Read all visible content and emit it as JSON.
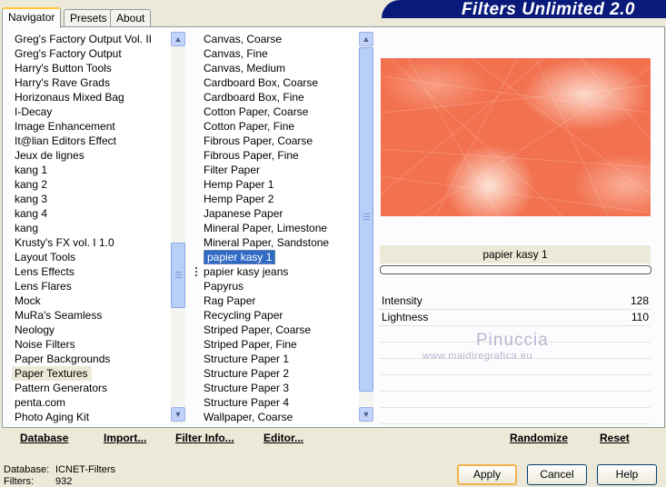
{
  "tabs": [
    "Navigator",
    "Presets",
    "About"
  ],
  "banner": "Filters Unlimited 2.0",
  "categories": [
    "Greg's Factory Output Vol. II",
    "Greg's Factory Output",
    "Harry's Button Tools",
    "Harry's Rave Grads",
    "Horizonaus Mixed Bag",
    "I-Decay",
    "Image Enhancement",
    "It@lian Editors Effect",
    "Jeux de lignes",
    "kang 1",
    "kang 2",
    "kang 3",
    "kang 4",
    "kang",
    "Krusty's FX vol. I 1.0",
    "Layout Tools",
    "Lens Effects",
    "Lens Flares",
    "Mock",
    "MuRa's Seamless",
    "Neology",
    "Noise Filters",
    "Paper Backgrounds",
    "Paper Textures",
    "Pattern Generators",
    "penta.com",
    "Photo Aging Kit"
  ],
  "selected_category": "Paper Textures",
  "filters": [
    "Canvas, Coarse",
    "Canvas, Fine",
    "Canvas, Medium",
    "Cardboard Box, Coarse",
    "Cardboard Box, Fine",
    "Cotton Paper, Coarse",
    "Cotton Paper, Fine",
    "Fibrous Paper, Coarse",
    "Fibrous Paper, Fine",
    "Filter Paper",
    "Hemp Paper 1",
    "Hemp Paper 2",
    "Japanese Paper",
    "Mineral Paper, Limestone",
    "Mineral Paper, Sandstone",
    "papier kasy 1",
    "papier kasy jeans",
    "Papyrus",
    "Rag Paper",
    "Recycling Paper",
    "Striped Paper, Coarse",
    "Striped Paper, Fine",
    "Structure Paper 1",
    "Structure Paper 2",
    "Structure Paper 3",
    "Structure Paper 4",
    "Wallpaper, Coarse"
  ],
  "selected_filter": "papier kasy 1",
  "preview": {
    "filter_name": "papier kasy 1",
    "color": "#f2714f"
  },
  "params": [
    {
      "label": "Intensity",
      "value": "128"
    },
    {
      "label": "Lightness",
      "value": "110"
    }
  ],
  "watermark": {
    "name": "Pinuccia",
    "url": "www.maidiregrafica.eu"
  },
  "links_left": {
    "database": "Database",
    "import": "Import...",
    "filter_info": "Filter Info...",
    "editor": "Editor..."
  },
  "links_right": {
    "randomize": "Randomize",
    "reset": "Reset"
  },
  "status": {
    "database_label": "Database:",
    "database_value": "ICNET-Filters",
    "filters_label": "Filters:",
    "filters_value": "932"
  },
  "buttons": {
    "apply": "Apply",
    "cancel": "Cancel",
    "help": "Help"
  },
  "icons": {
    "scroll_up": "up-arrow-icon",
    "scroll_down": "down-arrow-icon"
  }
}
